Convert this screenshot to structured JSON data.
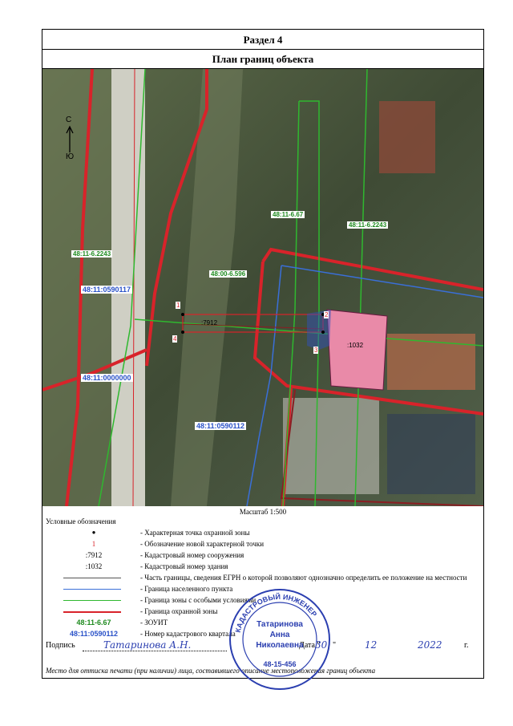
{
  "section_title": "Раздел 4",
  "subtitle": "План границ объекта",
  "compass": {
    "north": "С",
    "south": "Ю"
  },
  "map": {
    "labels": {
      "zone_left": "48:11-6.2243",
      "zone_top": "48:11-6.67",
      "zone_right": "48:11-6.2243",
      "zone_mid": "48:00-6.596",
      "quarter_0590117": "48:11:0590117",
      "quarter_0000000": "48:11:0000000",
      "quarter_0590112": "48:11:0590112",
      "structure": ":7912",
      "building": ":1032"
    },
    "points": [
      "1",
      "2",
      "3",
      "4"
    ]
  },
  "scale": "Масштаб 1:500",
  "legend": {
    "title": "Условные обозначения",
    "items": [
      {
        "symbol": "●",
        "text": "- Характерная точка охранной зоны"
      },
      {
        "symbol": "1",
        "text": "- Обозначение новой характерной точки"
      },
      {
        "symbol": ":7912",
        "text": "- Кадастровый номер сооружения"
      },
      {
        "symbol": ":1032",
        "text": "- Кадастровый номер здания"
      },
      {
        "symbol": "",
        "text": "- Часть границы, сведения ЕГРН о которой позволяют однозначно определить ее положение на местности"
      },
      {
        "symbol": "",
        "text": "- Граница населенного пункта"
      },
      {
        "symbol": "",
        "text": "- Граница зоны с особыми условиями"
      },
      {
        "symbol": "",
        "text": "- Граница охранной зоны"
      },
      {
        "symbol": "48:11-6.67",
        "text": "- ЗОУИТ"
      },
      {
        "symbol": "48:11:0590112",
        "text": "- Номер кадастрового квартала"
      }
    ]
  },
  "signature": {
    "label": "Подпись",
    "handwriting": "Татаринова А.Н.",
    "date_label": "Дата \"",
    "day": "30",
    "month": "12",
    "year": "2022",
    "year_suffix": "г."
  },
  "stamp": {
    "top_text": "КАДАСТРОВЫЙ ИНЖЕНЕР",
    "name1": "Татаринова",
    "name2": "Анна",
    "name3": "Николаевна",
    "number": "48-15-456"
  },
  "footer": "Место для оттиска печати (при наличии) лица, составившего описание местоположения границ объекта",
  "colors": {
    "red_zone": "#d8232a",
    "green_zone": "#2fb82f",
    "blue_boundary": "#3a6fd8",
    "building_fill": "#e98aa8",
    "zone_label": "#1e8a1e",
    "quarter_label": "#2a52c8",
    "point_label": "#d8232a"
  }
}
